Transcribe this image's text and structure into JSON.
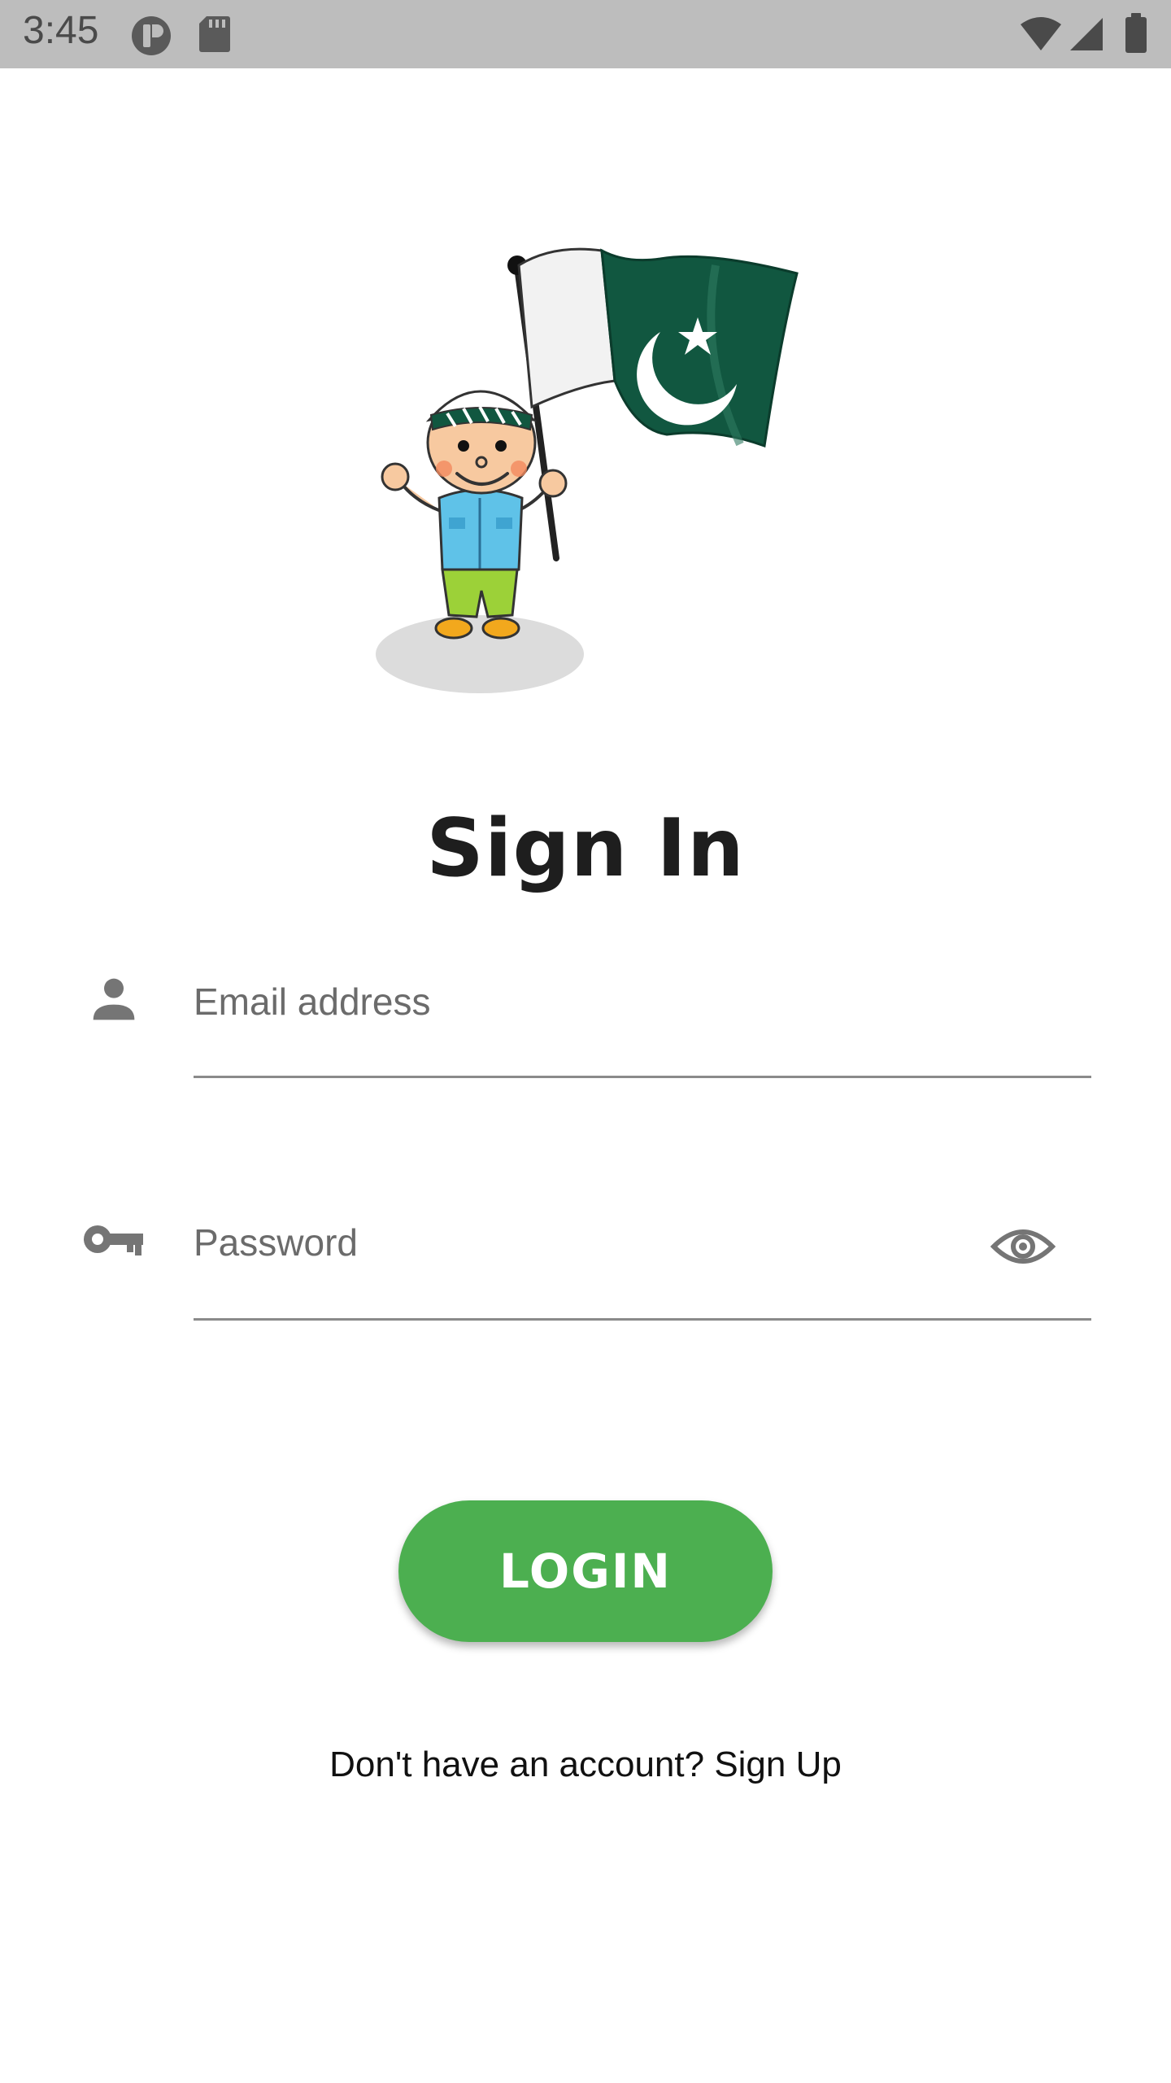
{
  "status_bar": {
    "time": "3:45",
    "background": "#bdbdbd",
    "left_icons": [
      "app-notification-icon",
      "sd-card-icon"
    ],
    "right_icons": [
      "wifi-icon",
      "cell-signal-icon",
      "battery-icon"
    ]
  },
  "header": {
    "title": "Sign In"
  },
  "form": {
    "email": {
      "placeholder": "Email address",
      "icon": "person-icon"
    },
    "password": {
      "placeholder": "Password",
      "icon": "key-icon",
      "toggle_icon": "eye-icon"
    },
    "login_label": "LOGIN",
    "signup_text": "Don't have an account? Sign Up"
  },
  "colors": {
    "accent": "#4caf50",
    "flag_green": "#115740",
    "text_dark": "#1e1e1e",
    "hint_gray": "#6b6b6b"
  }
}
